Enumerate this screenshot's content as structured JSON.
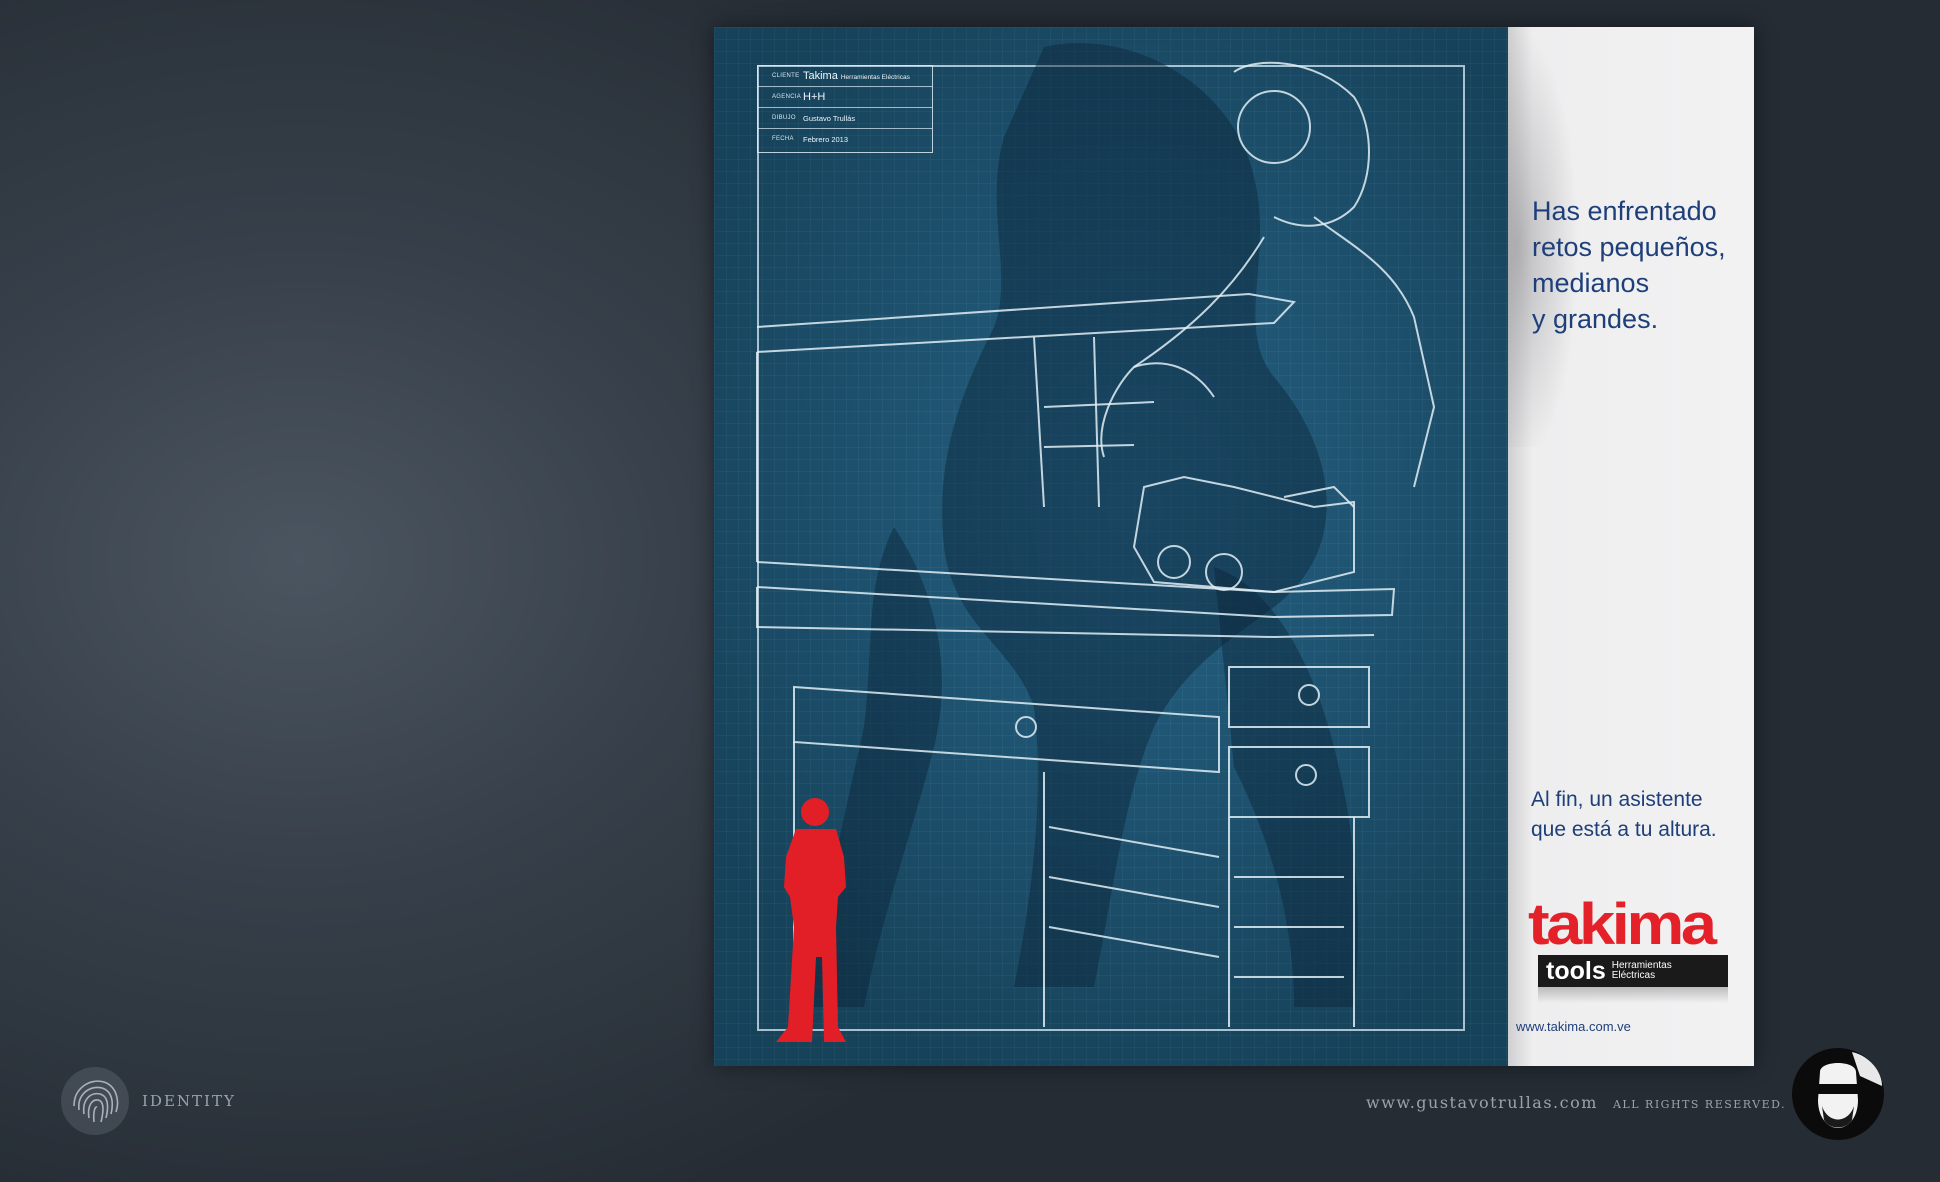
{
  "title_block": [
    {
      "key": "CLIENTE",
      "value": "Takima",
      "value_extra": "Herramientas Eléctricas"
    },
    {
      "key": "AGENCIA",
      "value": "H+H"
    },
    {
      "key": "DIBUJO",
      "value": "Gustavo Trullás"
    },
    {
      "key": "FECHA",
      "value": "Febrero 2013"
    }
  ],
  "headline": [
    "Has enfrentado",
    "retos pequeños,",
    "medianos",
    "y grandes."
  ],
  "subline": [
    "Al fin, un asistente",
    "que está a tu altura."
  ],
  "brand": {
    "logo_word": "takima",
    "tools_word": "tools",
    "tools_desc_1": "Herramientas",
    "tools_desc_2": "Eléctricas",
    "url": "www.takima.com.ve"
  },
  "footer": {
    "section_label": "IDENTITY",
    "site": "www.gustavotrullas.com",
    "rights": "ALL RIGHTS RESERVED."
  },
  "colors": {
    "blueprint": "#1e5878",
    "headline_text": "#1e3f7a",
    "brand_red": "#e42128"
  },
  "icons": [
    "fingerprint-icon",
    "avatar-sticker-icon"
  ]
}
